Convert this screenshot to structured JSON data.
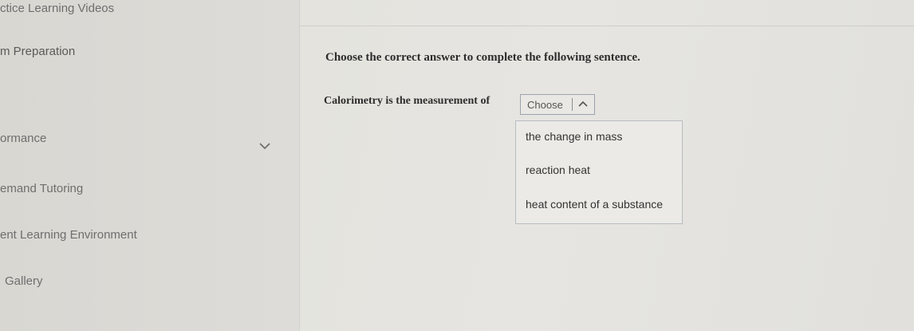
{
  "sidebar": {
    "items": [
      {
        "label": "ctice Learning Videos"
      },
      {
        "label": "m Preparation"
      },
      {
        "label": "ormance"
      },
      {
        "label": "emand Tutoring"
      },
      {
        "label": "ent Learning Environment"
      },
      {
        "label": "Gallery"
      }
    ]
  },
  "question": {
    "instruction": "Choose the correct answer to complete the following sentence.",
    "sentence": "Calorimetry is the measurement of",
    "select_value": "Choose",
    "options": [
      {
        "label": "the change in mass"
      },
      {
        "label": "reaction heat"
      },
      {
        "label": "heat content of a substance"
      }
    ]
  },
  "icons": {
    "expand": "chevron-down-icon",
    "collapse": "caret-up-icon"
  },
  "colors": {
    "select_border": "#9aa3ad",
    "dropdown_border": "#b7bcc2"
  }
}
